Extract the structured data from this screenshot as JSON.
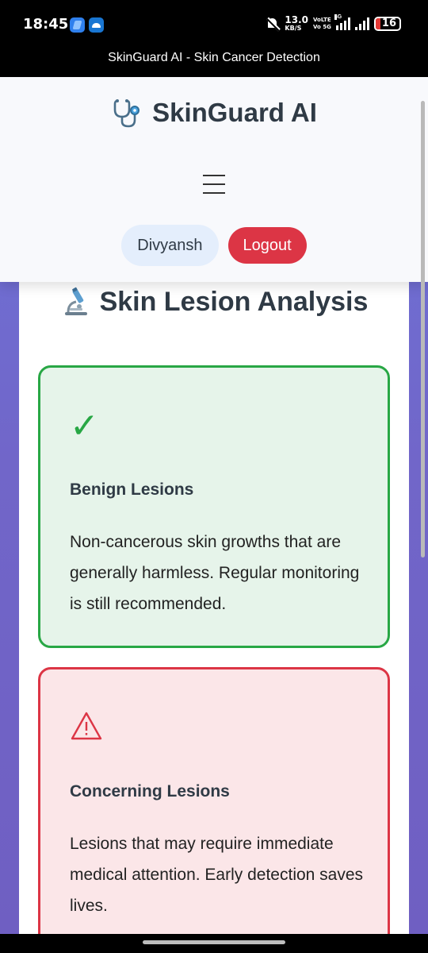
{
  "status_bar": {
    "time": "18:45",
    "net_speed_value": "13.0",
    "net_speed_unit": "KB/S",
    "volte_top": "VoLTE",
    "volte_bottom": "Vo 5G",
    "network_type": "4G",
    "battery": "16",
    "battery_color": "#e53935"
  },
  "window": {
    "title": "SkinGuard AI - Skin Cancer Detection"
  },
  "header": {
    "brand_icon": "stethoscope-icon",
    "brand_name": "SkinGuard AI",
    "menu_icon": "hamburger-icon",
    "username": "Divyansh",
    "logout_label": "Logout"
  },
  "analysis": {
    "icon": "microscope-icon",
    "title": "Skin Lesion Analysis",
    "benign": {
      "icon": "checkmark-icon",
      "icon_glyph": "✓",
      "title": "Benign Lesions",
      "description": "Non-cancerous skin growths that are generally harmless. Regular monitoring is still recommended."
    },
    "concerning": {
      "icon": "warning-icon",
      "title": "Concerning Lesions",
      "description": "Lesions that may require immediate medical attention. Early detection saves lives."
    }
  },
  "colors": {
    "accent_gradient_start": "#6d73d8",
    "accent_gradient_end": "#6f5fc2",
    "success": "#28a745",
    "danger": "#dc3545",
    "success_bg": "#e6f4ea",
    "danger_bg": "#fbe6e8"
  }
}
